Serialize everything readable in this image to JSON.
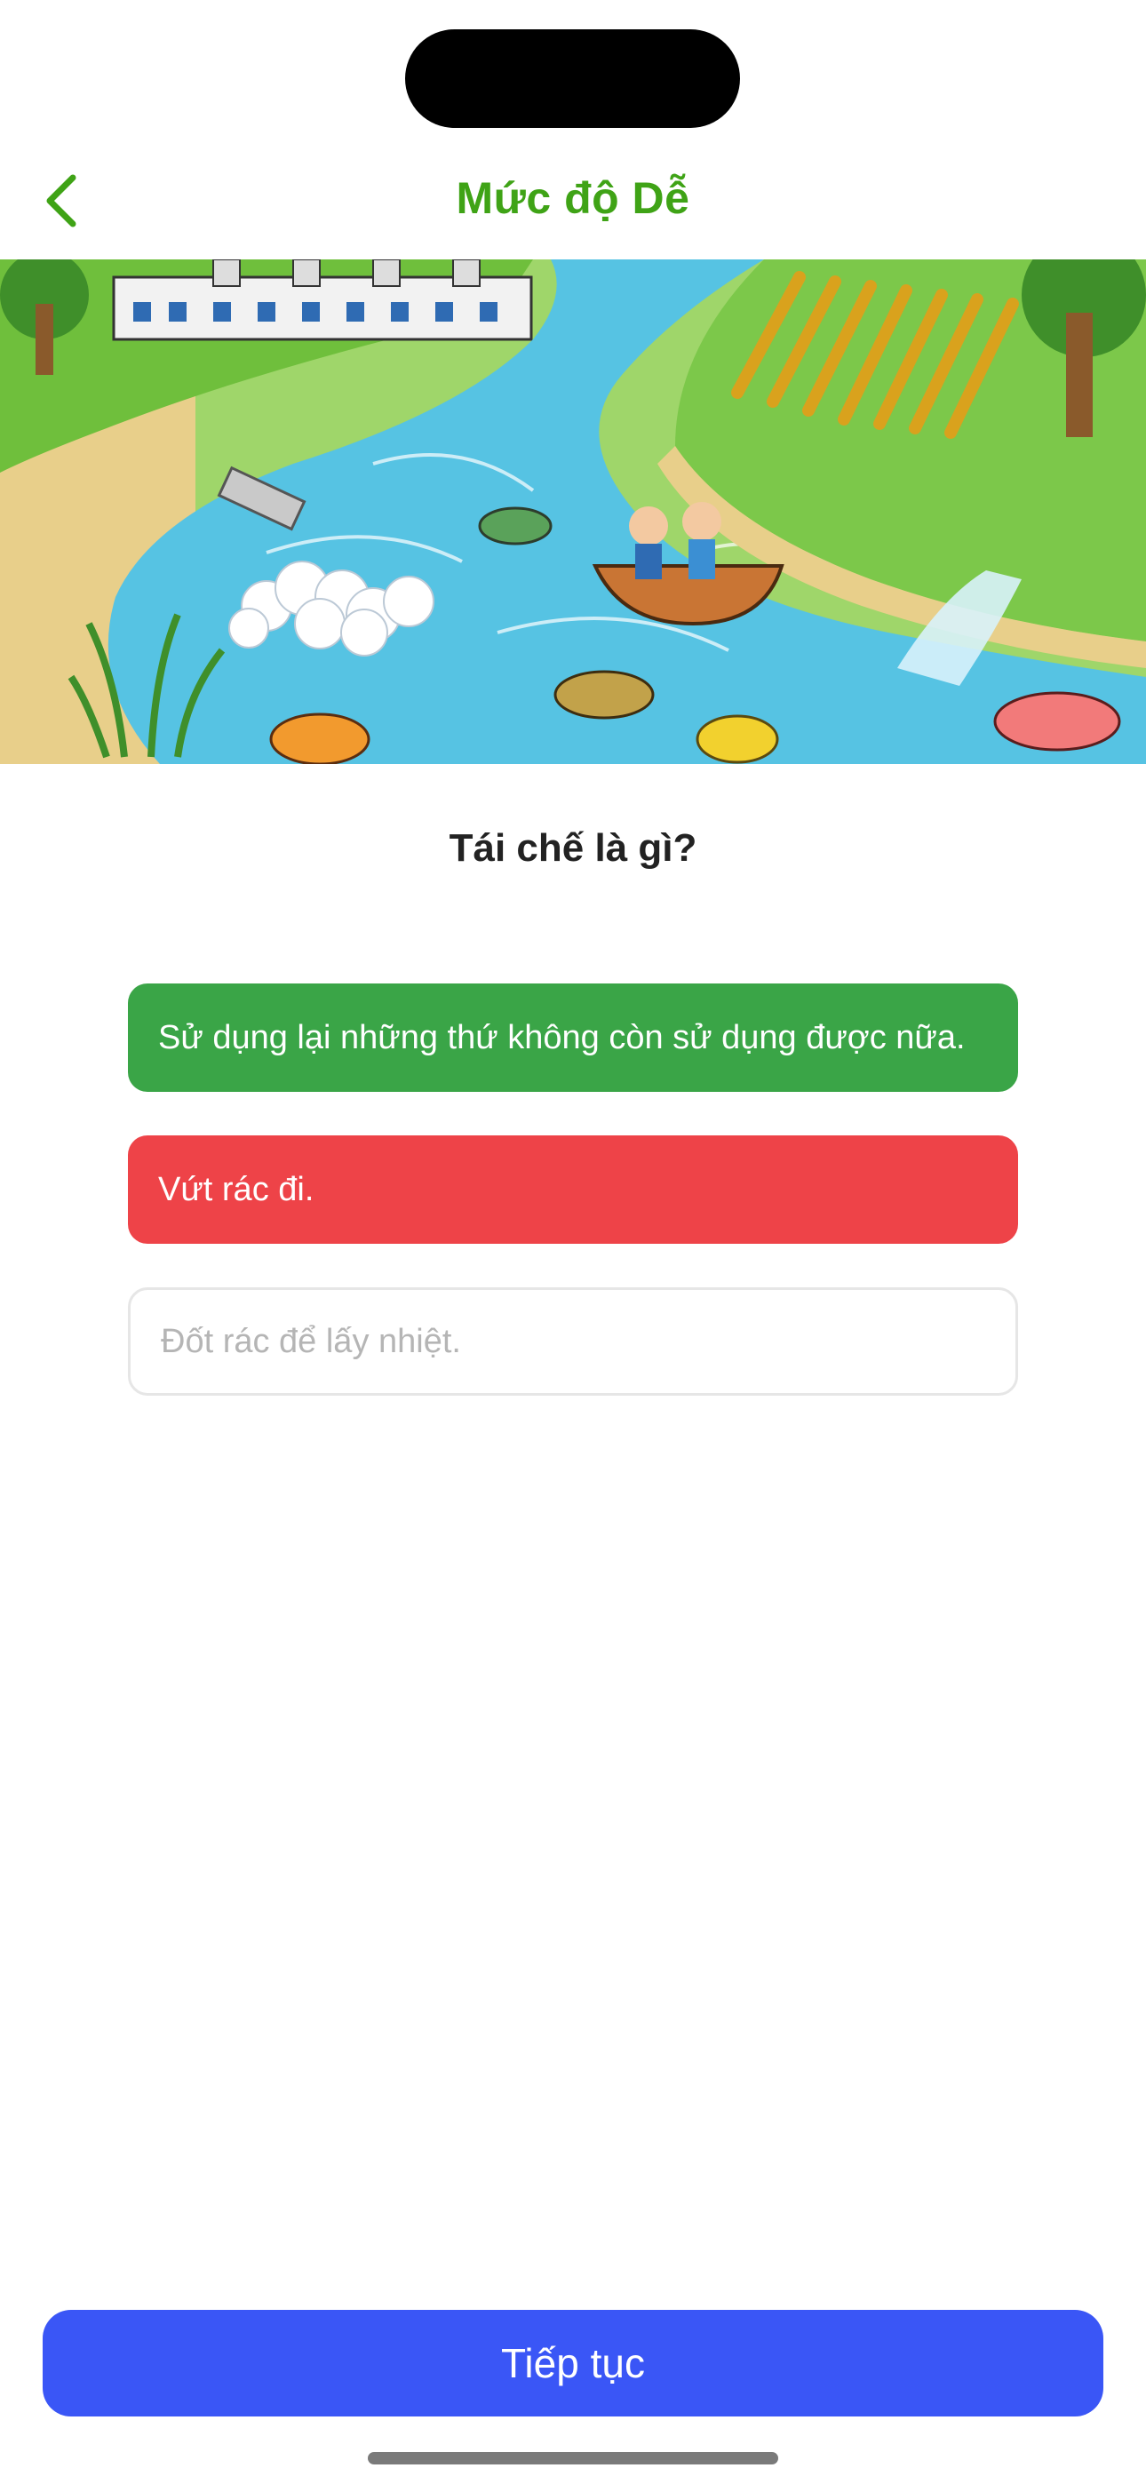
{
  "header": {
    "title": "Mức độ Dễ",
    "back_icon": "chevron-left-icon",
    "accent_color": "#3fa316"
  },
  "illustration": {
    "subject": "cartoon river with factory, boat, fish, crops"
  },
  "quiz": {
    "question": "Tái chế là gì?",
    "answers": [
      {
        "label": "Sử dụng lại những thứ không còn sử dụng được nữa.",
        "state": "correct",
        "color": "#3aa547"
      },
      {
        "label": "Vứt rác đi.",
        "state": "wrong",
        "color": "#ee4348"
      },
      {
        "label": "Đốt rác để lấy nhiệt.",
        "state": "neutral",
        "color": "#ffffff"
      }
    ]
  },
  "footer": {
    "continue_label": "Tiếp tục",
    "continue_color": "#3a56f6"
  }
}
